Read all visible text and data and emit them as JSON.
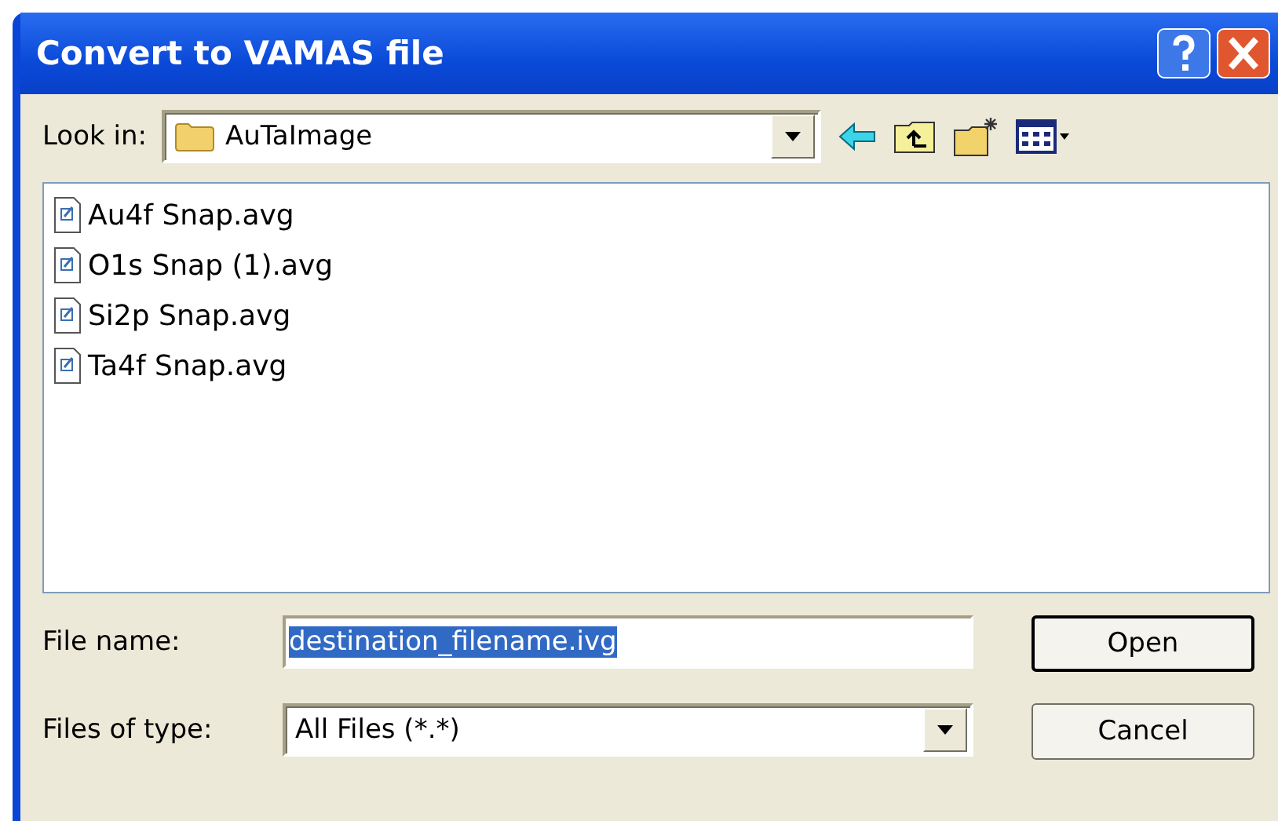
{
  "window": {
    "title": "Convert to VAMAS file"
  },
  "look_in": {
    "label": "Look in:",
    "value": "AuTaImage"
  },
  "files": [
    {
      "name": "Au4f Snap.avg",
      "selected": false
    },
    {
      "name": "O1s Snap (1).avg",
      "selected": false
    },
    {
      "name": "Si2p Snap.avg",
      "selected": false
    },
    {
      "name": "Ta4f Snap.avg",
      "selected": false
    }
  ],
  "file_name": {
    "label": "File name:",
    "value": "destination_filename.ivg",
    "highlighted": true
  },
  "files_of_type": {
    "label": "Files of type:",
    "value": "All Files (*.*)"
  },
  "buttons": [
    {
      "label": "Open",
      "default": true
    },
    {
      "label": "Cancel",
      "default": false
    }
  ]
}
